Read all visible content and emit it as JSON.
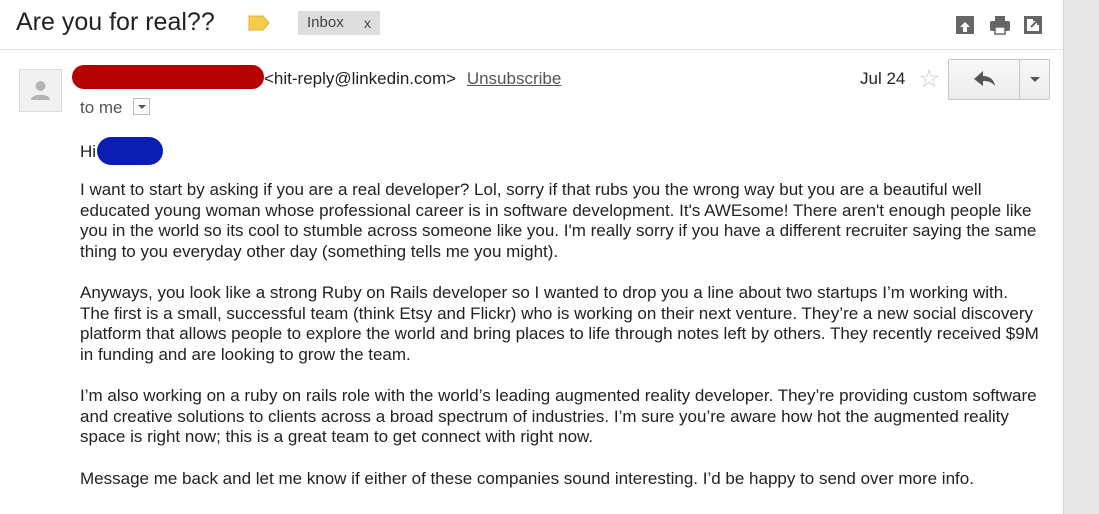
{
  "subject": "Are you for real??",
  "label_chip": {
    "text": "Inbox",
    "remove": "x"
  },
  "header_icons": [
    "print-all-icon",
    "print-icon",
    "new-window-icon"
  ],
  "message": {
    "sender_email": "<hit-reply@linkedin.com>",
    "unsubscribe": "Unsubscribe",
    "to": "to me",
    "date": "Jul 24",
    "greeting": "Hi",
    "paragraphs": [
      "I want to start by asking if you are a real developer? Lol, sorry if that rubs you the wrong way but you are a beautiful well educated young woman whose professional career is in software development. It's AWEsome! There aren't enough people like you in the world so its cool to stumble across someone like you. I'm really sorry if you have a different recruiter saying the same thing to you everyday other day (something tells me you might).",
      "Anyways, you look like a strong Ruby on Rails developer so I wanted to drop you a line about two startups I’m working with. The first is a small, successful team (think Etsy and Flickr) who is working on their next venture. They’re a new social discovery platform that allows people to explore the world and bring places to life through notes left by others. They recently received $9M in funding and are looking to grow the team.",
      "I’m also working on a ruby on rails role with the world’s leading augmented reality developer. They’re providing custom software and creative solutions to clients across a broad spectrum of industries. I’m sure you’re aware how hot the augmented reality space is right now; this is a great team to get connect with right now.",
      "Message me back and let me know if either of these companies sound interesting. I’d be happy to send over more info."
    ]
  },
  "colors": {
    "sender_redaction": "#b50000",
    "name_redaction": "#0a1eb4",
    "label_marker": "#f7cb4d",
    "chip_bg": "#dddddd"
  }
}
